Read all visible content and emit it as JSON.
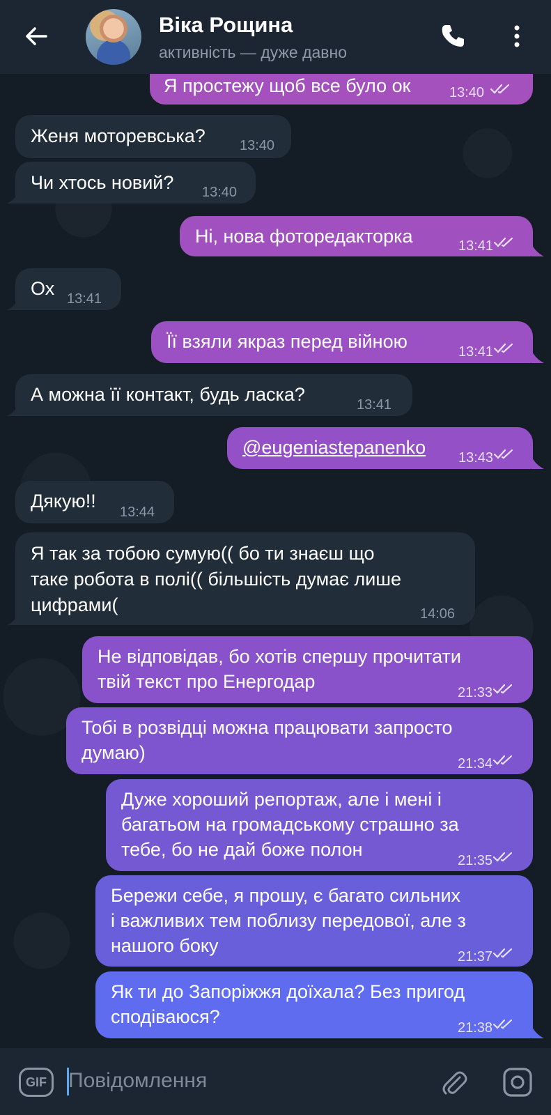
{
  "header": {
    "title": "Віка Рощина",
    "subtitle": "активність — дуже давно"
  },
  "messages": [
    {
      "dir": "out",
      "text": "Я простежу щоб все було ок",
      "time": "13:40"
    },
    {
      "dir": "in",
      "text": "Женя моторевська?",
      "time": "13:40"
    },
    {
      "dir": "in",
      "text": "Чи хтось новий?",
      "time": "13:40"
    },
    {
      "dir": "out",
      "text": "Ні, нова фоторедакторка",
      "time": "13:41"
    },
    {
      "dir": "in",
      "text": "Ох",
      "time": "13:41"
    },
    {
      "dir": "out",
      "text": "Її взяли якраз перед війною",
      "time": "13:41"
    },
    {
      "dir": "in",
      "text": "А можна її контакт, будь ласка?",
      "time": "13:41"
    },
    {
      "dir": "out",
      "text": "@eugeniastepanenko",
      "time": "13:43"
    },
    {
      "dir": "in",
      "text": "Дякую!!",
      "time": "13:44"
    },
    {
      "dir": "in",
      "lines": [
        "Я так за тобою сумую(( бо ти знаєш що",
        "таке робота в полі(( більшість думає лише",
        "цифрами("
      ],
      "time": "14:06"
    },
    {
      "dir": "out",
      "lines": [
        "Не відповідав, бо хотів спершу прочитати",
        "твій текст про Енергодар"
      ],
      "time": "21:33"
    },
    {
      "dir": "out",
      "lines": [
        "Тобі в розвідці можна працювати запросто",
        "думаю)"
      ],
      "time": "21:34"
    },
    {
      "dir": "out",
      "lines": [
        "Дуже хороший репортаж, але і мені і",
        "багатьом на громадському страшно за",
        "тебе, бо не дай боже полон"
      ],
      "time": "21:35"
    },
    {
      "dir": "out",
      "lines": [
        "Бережи себе, я прошу, є багато сильних",
        "і важливих тем поблизу передової, але з",
        "нашого боку"
      ],
      "time": "21:37"
    },
    {
      "dir": "out",
      "lines": [
        "Як ти до Запоріжжя доїхала? Без пригод",
        "сподіваюся?"
      ],
      "time": "21:38"
    }
  ],
  "input": {
    "placeholder": "Повідомлення",
    "gif_label": "GIF"
  },
  "colors": {
    "incoming_bubble": "#222d3a",
    "outgoing_gradient_top": "#a04fbf",
    "outgoing_gradient_bottom": "#5f6cf0",
    "header_bg": "#1c2633"
  },
  "icons": [
    "back-arrow-icon",
    "phone-icon",
    "more-vertical-icon",
    "gif-icon",
    "attach-icon",
    "camera-icon",
    "double-check-icon"
  ]
}
